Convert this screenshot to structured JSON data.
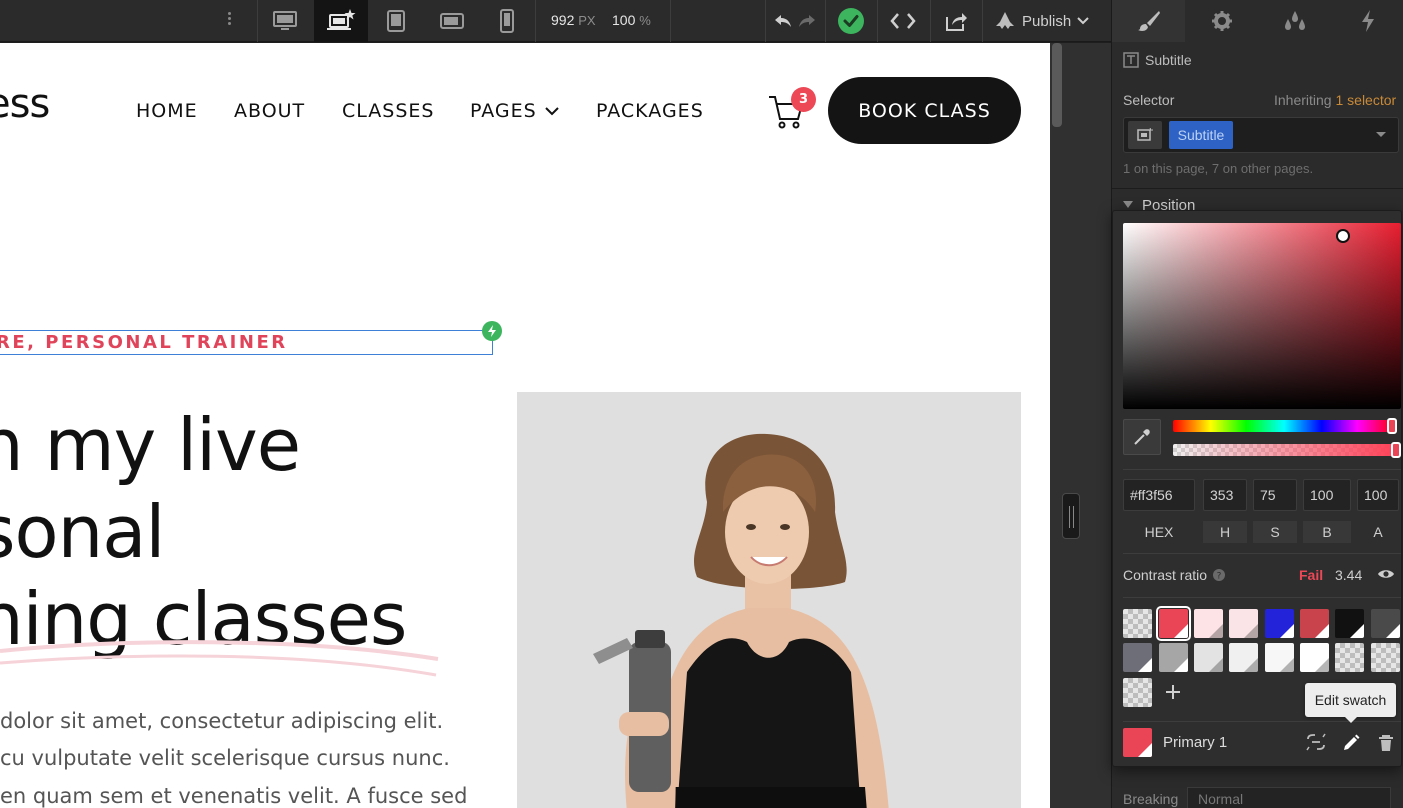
{
  "toolbar": {
    "width_value": "992",
    "width_unit": "PX",
    "zoom_value": "100",
    "zoom_unit": "%",
    "publish_label": "Publish"
  },
  "canvas": {
    "logo": "ess",
    "nav": [
      "HOME",
      "ABOUT",
      "CLASSES",
      "PAGES",
      "PACKAGES"
    ],
    "cart_count": "3",
    "book_button": "BOOK CLASS",
    "subtitle": "RE, PERSONAL TRAINER",
    "heading_lines": [
      "n my live",
      "sonal",
      "ning classes"
    ],
    "paragraph_lines": [
      "dolor sit amet, consectetur adipiscing elit.",
      "cu vulputate velit scelerisque cursus nunc.",
      "en quam sem et venenatis velit. A fusce sed"
    ]
  },
  "panel": {
    "element_label": "Subtitle",
    "selector_label": "Selector",
    "inheriting_label": "Inheriting",
    "inheriting_count": "1 selector",
    "selector_tag": "Subtitle",
    "usage_text": "1 on this page, 7 on other pages.",
    "position_label": "Position",
    "breaking_label": "Breaking",
    "breaking_value": "Normal"
  },
  "picker": {
    "hex": "#ff3f56",
    "h": "353",
    "s": "75",
    "b": "100",
    "a": "100",
    "labels": [
      "HEX",
      "H",
      "S",
      "B",
      "A"
    ],
    "contrast_label": "Contrast ratio",
    "contrast_status": "Fail",
    "contrast_value": "3.44",
    "swatch_name": "Primary 1",
    "tooltip": "Edit swatch",
    "accent": "#ec4856",
    "swatches_row1": [
      "checker",
      "#e94556",
      "#fde3e6",
      "#fbe4e7",
      "#2323d9",
      "#c9434d",
      "#111111",
      "#4a4a4a"
    ],
    "swatches_row2": [
      "#6e6e78",
      "#a6a6a6",
      "#e3e3e3",
      "#f0f0f0",
      "#f7f7f7",
      "#ffffff",
      "checker",
      "checker"
    ],
    "swatches_row3": [
      "checker"
    ]
  }
}
